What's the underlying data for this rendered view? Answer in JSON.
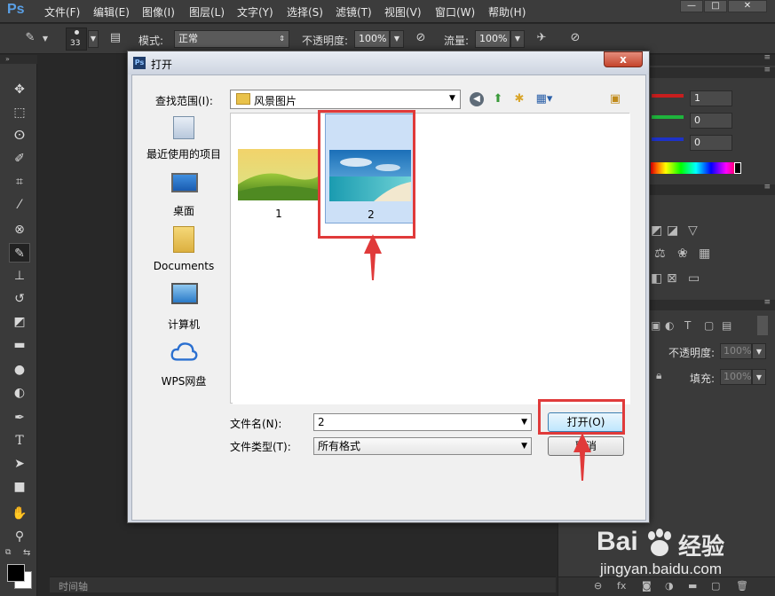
{
  "app": {
    "logo": "Ps",
    "menu": [
      "文件(F)",
      "编辑(E)",
      "图像(I)",
      "图层(L)",
      "文字(Y)",
      "选择(S)",
      "滤镜(T)",
      "视图(V)",
      "窗口(W)",
      "帮助(H)"
    ]
  },
  "options_bar": {
    "brush_size": "33",
    "mode_label": "模式:",
    "mode_value": "正常",
    "opacity_label": "不透明度:",
    "opacity_value": "100%",
    "flow_label": "流量:",
    "flow_value": "100%"
  },
  "workspace": {
    "timeline_tab": "时间轴"
  },
  "right_panel": {
    "color_values": [
      "1",
      "0",
      "0"
    ],
    "layer_opacity_label": "不透明度:",
    "layer_opacity_value": "100%",
    "fill_label": "填充:",
    "fill_value": "100%"
  },
  "dialog": {
    "title": "打开",
    "close_label": "x",
    "lookin_label": "查找范围(I):",
    "lookin_value": "风景图片",
    "places": [
      {
        "label": "最近使用的项目",
        "icon": "recent-items-icon"
      },
      {
        "label": "桌面",
        "icon": "desktop-icon"
      },
      {
        "label": "Documents",
        "icon": "documents-folder-icon"
      },
      {
        "label": "计算机",
        "icon": "computer-icon"
      },
      {
        "label": "WPS网盘",
        "icon": "cloud-icon"
      }
    ],
    "files": [
      {
        "name": "1",
        "thumbnail": "green-hills-landscape"
      },
      {
        "name": "2",
        "thumbnail": "tropical-beach"
      }
    ],
    "filename_label": "文件名(N):",
    "filename_value": "2",
    "filetype_label": "文件类型(T):",
    "filetype_value": "所有格式",
    "open_button": "打开(O)",
    "cancel_button": "取消"
  },
  "watermark": {
    "brand": "Bai",
    "brand_suffix": "经验",
    "url": "jingyan.baidu.com"
  },
  "colors": {
    "annotation_red": "#e03a3a",
    "selection_blue": "#cce0f7",
    "ps_dark": "#282828"
  }
}
